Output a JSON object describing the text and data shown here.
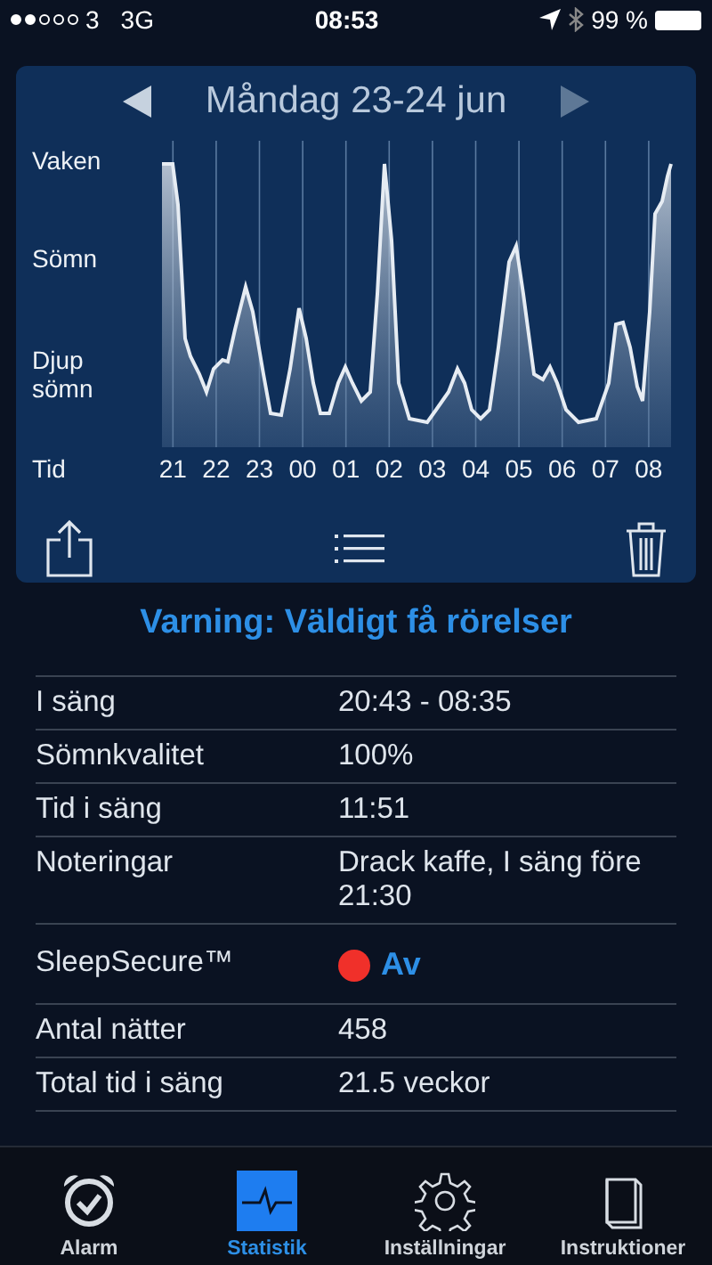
{
  "status_bar": {
    "carrier": "3",
    "network": "3G",
    "time": "08:53",
    "battery": "99 %"
  },
  "graph": {
    "title": "Måndag 23-24 jun",
    "y_labels": [
      "Vaken",
      "Sömn",
      "Djup\nsömn"
    ],
    "x_title": "Tid",
    "hours": [
      "21",
      "22",
      "23",
      "00",
      "01",
      "02",
      "03",
      "04",
      "05",
      "06",
      "07",
      "08"
    ]
  },
  "warning": "Varning: Väldigt få rörelser",
  "rows": [
    {
      "kind": "text",
      "label": "I säng",
      "value": "20:43 - 08:35"
    },
    {
      "kind": "text",
      "label": "Sömnkvalitet",
      "value": "100%"
    },
    {
      "kind": "text",
      "label": "Tid i säng",
      "value": "11:51"
    },
    {
      "kind": "text",
      "label": "Noteringar",
      "value": "Drack kaffe, I säng före 21:30"
    },
    {
      "kind": "status",
      "label": "SleepSecure™",
      "value": "Av",
      "color": "#f0302a"
    },
    {
      "kind": "text",
      "label": "Antal nätter",
      "value": "458"
    },
    {
      "kind": "text",
      "label": "Total tid i säng",
      "value": "21.5 veckor"
    }
  ],
  "tabs": [
    {
      "label": "Alarm",
      "selected": false
    },
    {
      "label": "Statistik",
      "selected": true
    },
    {
      "label": "Inställningar",
      "selected": false
    },
    {
      "label": "Instruktioner",
      "selected": false
    }
  ]
}
